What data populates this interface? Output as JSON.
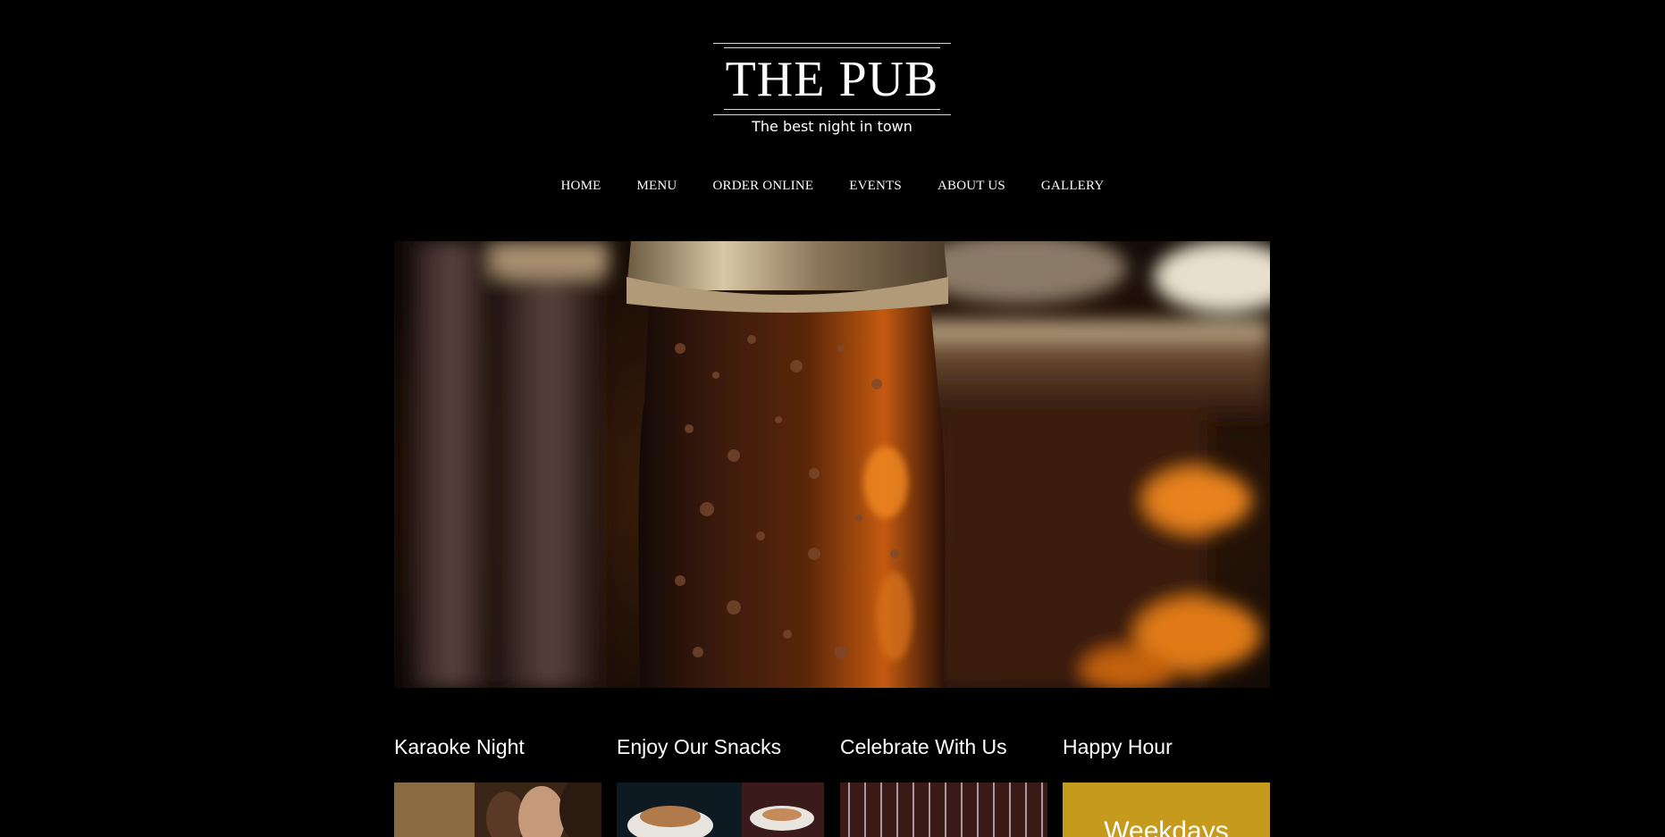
{
  "logo": {
    "title": "THE PUB",
    "tagline": "The best night in town"
  },
  "nav": {
    "items": [
      {
        "label": "HOME"
      },
      {
        "label": "MENU"
      },
      {
        "label": "ORDER ONLINE"
      },
      {
        "label": "EVENTS"
      },
      {
        "label": "ABOUT US"
      },
      {
        "label": "GALLERY"
      }
    ]
  },
  "hero": {
    "image": "beer-bottles-photo"
  },
  "sections": [
    {
      "title": "Karaoke Night",
      "image": "karaoke-crowd-photo"
    },
    {
      "title": "Enjoy Our Snacks",
      "image": "snack-plates-photo"
    },
    {
      "title": "Celebrate With Us",
      "image": "glasses-photo"
    },
    {
      "title": "Happy Hour",
      "box_text": "Weekdays"
    }
  ],
  "colors": {
    "background": "#000000",
    "text": "#ffffff",
    "happy_hour_box": "#c69a1c"
  }
}
